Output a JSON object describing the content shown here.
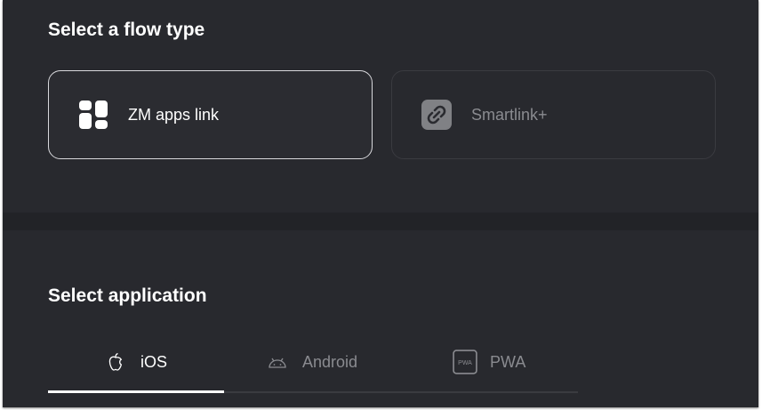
{
  "flow": {
    "title": "Select a flow type",
    "options": [
      {
        "label": "ZM apps link",
        "icon": "apps-grid-icon",
        "selected": true
      },
      {
        "label": "Smartlink+",
        "icon": "link-icon",
        "selected": false
      }
    ]
  },
  "application": {
    "title": "Select application",
    "tabs": [
      {
        "label": "iOS",
        "icon": "apple-icon",
        "active": true
      },
      {
        "label": "Android",
        "icon": "android-icon",
        "active": false
      },
      {
        "label": "PWA",
        "icon": "pwa-icon",
        "icon_text": "PWA",
        "active": false
      }
    ]
  },
  "colors": {
    "background": "#28292e",
    "text": "#ffffff",
    "muted": "#8a8b90"
  }
}
